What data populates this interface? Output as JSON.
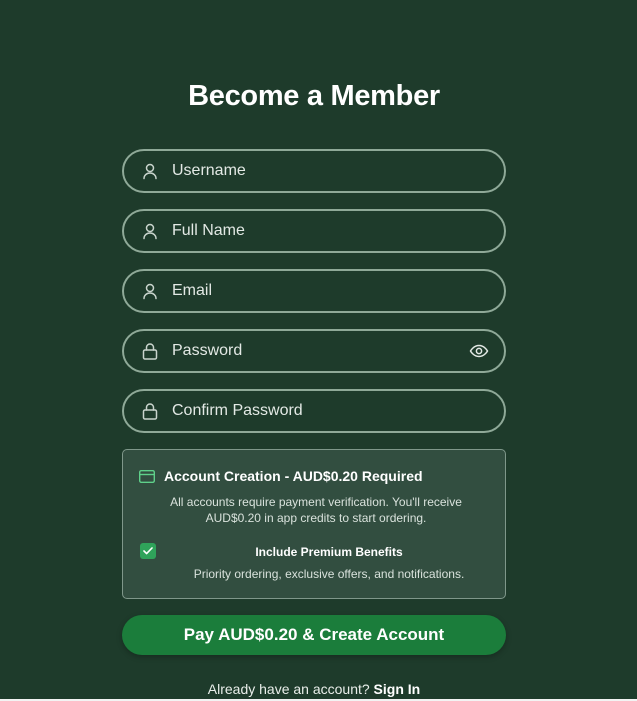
{
  "page": {
    "title": "Become a Member"
  },
  "form": {
    "username_placeholder": "Username",
    "fullname_placeholder": "Full Name",
    "email_placeholder": "Email",
    "password_placeholder": "Password",
    "confirm_password_placeholder": "Confirm Password"
  },
  "payment_card": {
    "title": "Account Creation - AUD$0.20 Required",
    "description": "All accounts require payment verification. You'll receive AUD$0.20 in app credits to start ordering.",
    "premium_checked": true,
    "premium_label": "Include Premium Benefits",
    "premium_description": "Priority ordering, exclusive offers, and notifications."
  },
  "actions": {
    "pay_button_label": "Pay AUD$0.20 & Create Account",
    "signin_prompt": "Already have an account?",
    "signin_link": "Sign In"
  },
  "colors": {
    "background": "#1e3b2b",
    "card_background": "#324e40",
    "field_border": "#8fa998",
    "accent_green": "#1b7d3b",
    "checkbox_green": "#2fa35a",
    "card_icon_green": "#5fd08a"
  },
  "icons": {
    "username": "user-icon",
    "fullname": "user-icon",
    "email": "user-icon",
    "password": "lock-icon",
    "confirm_password": "lock-icon",
    "password_toggle": "eye-icon",
    "card": "credit-card-icon",
    "checkbox": "check-icon"
  }
}
